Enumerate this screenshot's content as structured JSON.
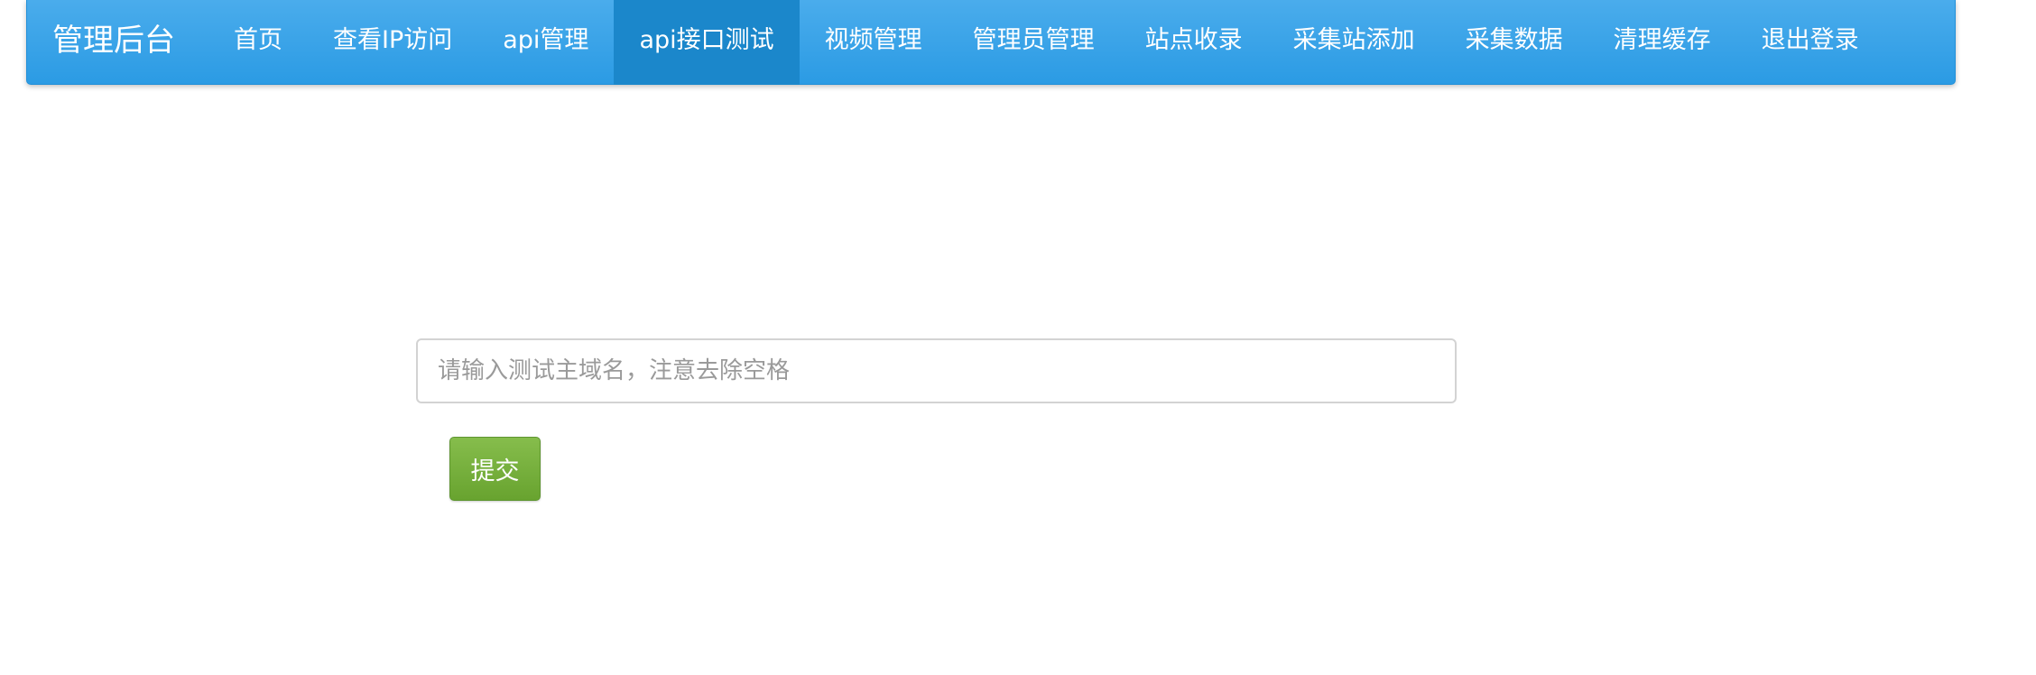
{
  "header": {
    "brand": "管理后台",
    "nav_items": [
      {
        "label": "首页",
        "active": false
      },
      {
        "label": "查看IP访问",
        "active": false
      },
      {
        "label": "api管理",
        "active": false
      },
      {
        "label": "api接口测试",
        "active": true
      },
      {
        "label": "视频管理",
        "active": false
      },
      {
        "label": "管理员管理",
        "active": false
      },
      {
        "label": "站点收录",
        "active": false
      },
      {
        "label": "采集站添加",
        "active": false
      },
      {
        "label": "采集数据",
        "active": false
      },
      {
        "label": "清理缓存",
        "active": false
      },
      {
        "label": "退出登录",
        "active": false
      }
    ]
  },
  "form": {
    "domain_input": {
      "value": "",
      "placeholder": "请输入测试主域名，注意去除空格"
    },
    "submit_label": "提交"
  },
  "colors": {
    "navbar": "#2b9be4",
    "nav_active": "#1b87cb",
    "submit_button": "#74ad3b"
  }
}
